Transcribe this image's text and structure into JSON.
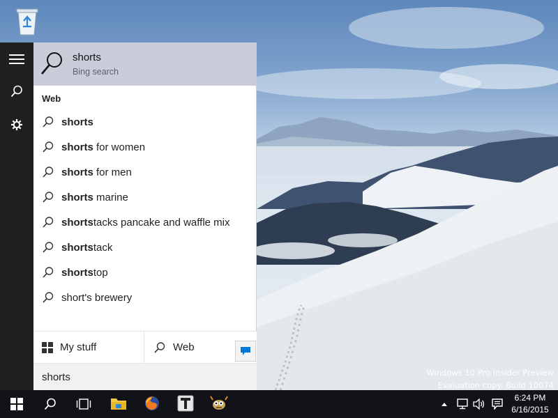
{
  "search": {
    "best_match": {
      "title": "shorts",
      "subtitle": "Bing search"
    },
    "section_label": "Web",
    "results": [
      {
        "bold": "shorts",
        "rest": ""
      },
      {
        "bold": "shorts",
        "rest": " for women"
      },
      {
        "bold": "shorts",
        "rest": " for men"
      },
      {
        "bold": "shorts",
        "rest": " marine"
      },
      {
        "bold": "shorts",
        "rest": "tacks pancake and waffle mix"
      },
      {
        "bold": "shorts",
        "rest": "tack"
      },
      {
        "bold": "shorts",
        "rest": "top"
      },
      {
        "bold": "",
        "rest": "short's brewery"
      }
    ],
    "tabs": {
      "my_stuff": "My stuff",
      "web": "Web"
    },
    "query": "shorts"
  },
  "desktop": {
    "watermark_line1": "Windows 10 Pro Insider Preview",
    "watermark_line2": "Evaluation copy. Build 10074"
  },
  "taskbar": {
    "time": "6:24 PM",
    "date": "6/16/2015",
    "apps": [
      "start-icon",
      "search-icon",
      "task-view-icon",
      "file-explorer-icon",
      "firefox-icon",
      "typora-icon",
      "gimp-icon"
    ],
    "tray": [
      "show-hidden-icons-icon",
      "network-icon",
      "volume-icon",
      "action-center-icon"
    ]
  },
  "colors": {
    "rail_bg": "#1f1f1f",
    "best_match_bg": "#c9ccd9",
    "taskbar_bg": "#111318",
    "accent": "#0078d7"
  }
}
